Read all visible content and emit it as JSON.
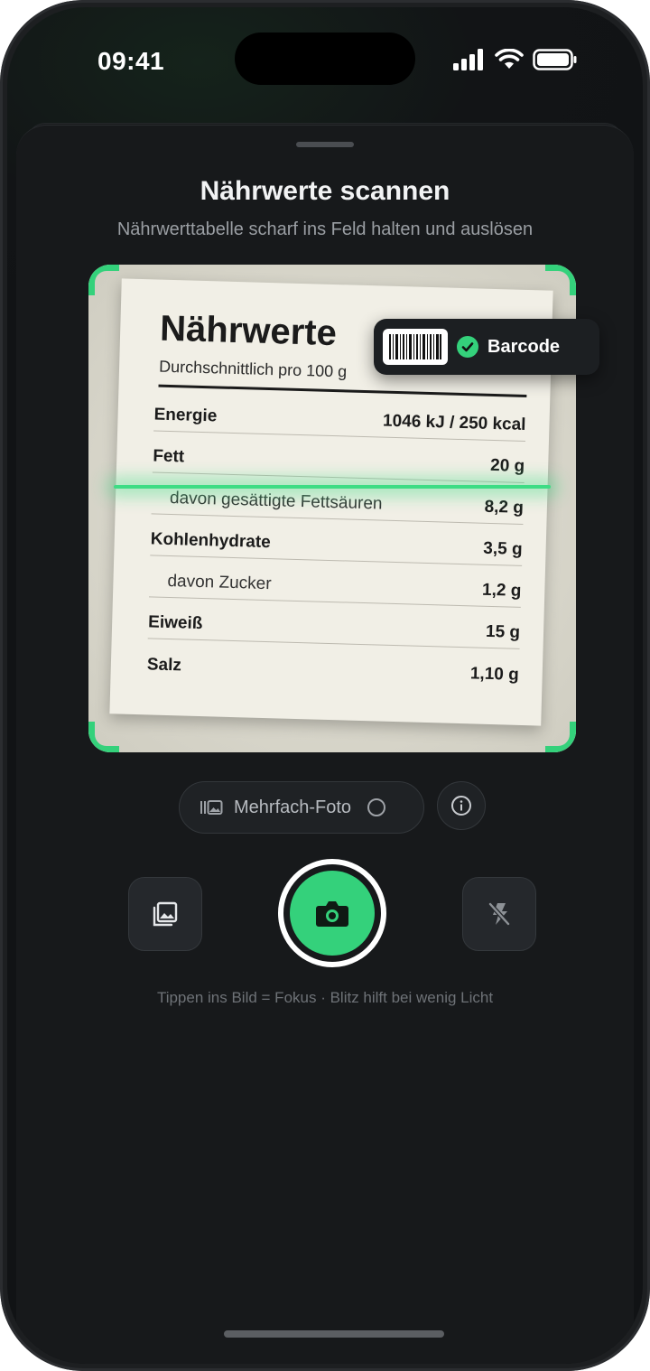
{
  "status_bar": {
    "time": "09:41"
  },
  "sheet": {
    "title": "Nährwerte scannen",
    "subtitle": "Nährwerttabelle scharf ins Feld halten und auslösen"
  },
  "label": {
    "heading": "Nährwerte",
    "per": "Durchschnittlich pro 100 g",
    "rows": [
      {
        "name": "Energie",
        "value": "1046 kJ / 250 kcal"
      },
      {
        "name": "Fett",
        "value": "20 g"
      },
      {
        "name": "davon gesättigte Fettsäuren",
        "value": "8,2 g"
      },
      {
        "name": "Kohlenhydrate",
        "value": "3,5 g"
      },
      {
        "name": "davon Zucker",
        "value": "1,2 g"
      },
      {
        "name": "Eiweiß",
        "value": "15 g"
      },
      {
        "name": "Salz",
        "value": "1,10 g"
      }
    ]
  },
  "badge": {
    "label": "Barcode",
    "icon": "check-circle-icon"
  },
  "mode": {
    "label": "Mehrfach-Foto",
    "icon": "multi-photo-icon",
    "selected": false
  },
  "controls": {
    "gallery_icon": "gallery-icon",
    "shutter_icon": "camera-icon",
    "flash_icon": "flash-off-icon"
  },
  "hint": "Tippen ins Bild = Fokus · Blitz hilft bei wenig Licht",
  "colors": {
    "accent": "#34d17b",
    "background": "#17191b"
  }
}
